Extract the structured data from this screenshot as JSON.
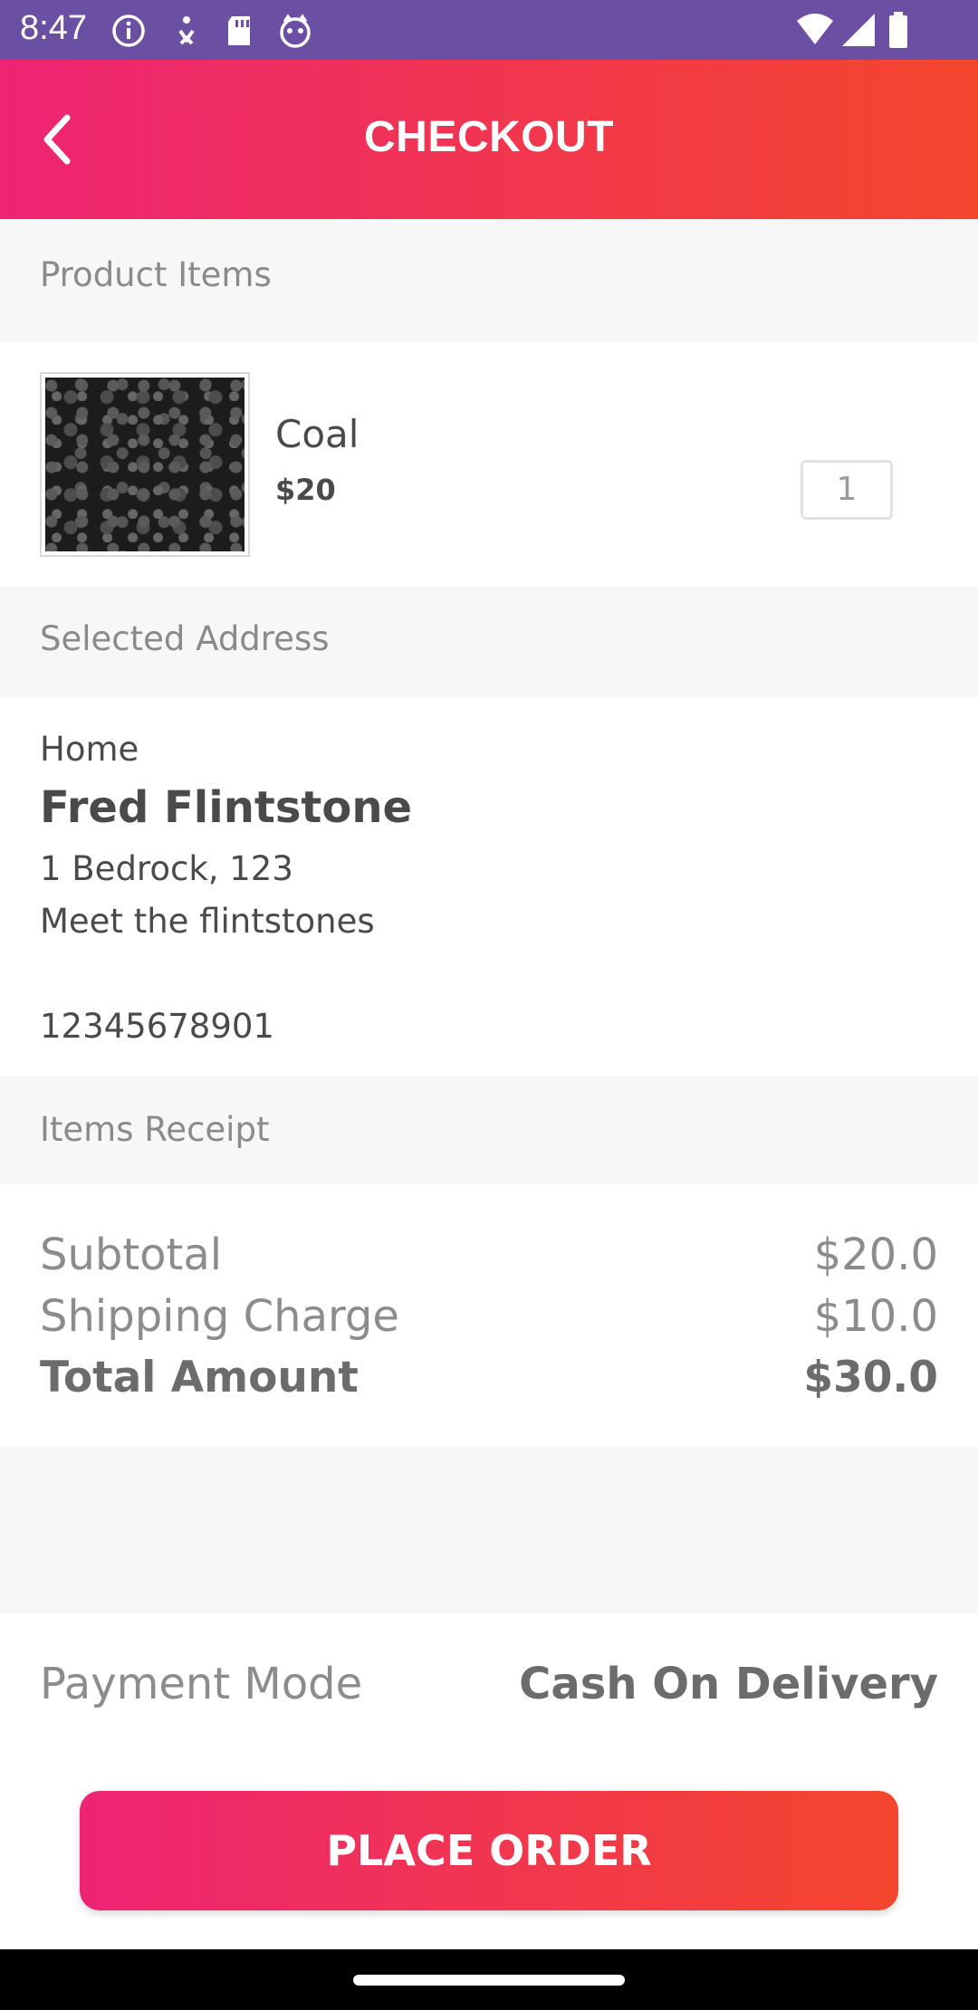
{
  "status_bar": {
    "time": "8:47"
  },
  "header": {
    "title": "CHECKOUT"
  },
  "sections": {
    "products": "Product Items",
    "address": "Selected Address",
    "receipt": "Items Receipt"
  },
  "product": {
    "name": "Coal",
    "price": "$20",
    "quantity": "1"
  },
  "address": {
    "type": "Home",
    "name": "Fred Flintstone",
    "line1": "1 Bedrock, 123",
    "line2": "Meet the flintstones",
    "phone": "12345678901"
  },
  "receipt": {
    "subtotal_label": "Subtotal",
    "subtotal": "$20.0",
    "shipping_label": "Shipping Charge",
    "shipping": "$10.0",
    "total_label": "Total Amount",
    "total": "$30.0"
  },
  "payment": {
    "label": "Payment Mode",
    "value": "Cash On Delivery"
  },
  "actions": {
    "place_order": "PLACE ORDER"
  },
  "colors": {
    "header_gradient_start": "#ee2474",
    "header_gradient_end": "#f4462d",
    "status_bar": "#6a4fa3"
  }
}
